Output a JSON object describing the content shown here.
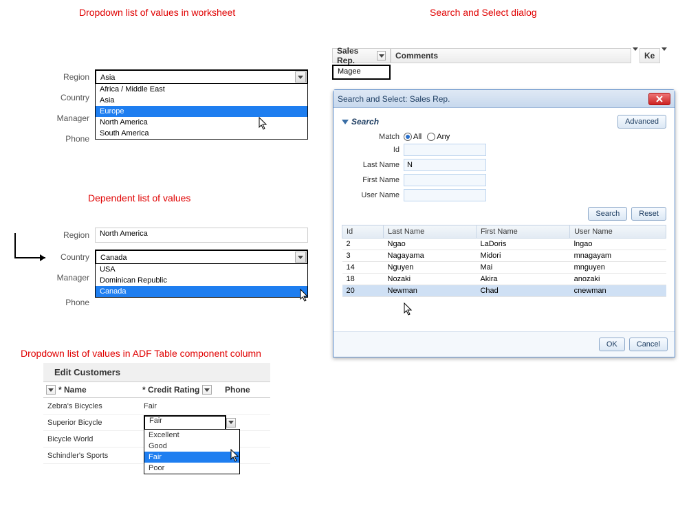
{
  "titles": {
    "lov_worksheet": "Dropdown list of values in worksheet",
    "dependent": "Dependent list of values",
    "lov_table": "Dropdown list of values in ADF Table component column",
    "search_dialog": "Search and Select dialog"
  },
  "worksheet_form": {
    "labels": {
      "region": "Region",
      "country": "Country",
      "manager": "Manager",
      "phone": "Phone"
    },
    "region_value": "Asia",
    "region_options": [
      "Africa / Middle East",
      "Asia",
      "Europe",
      "North America",
      "South America"
    ],
    "region_selected": "Europe"
  },
  "dependent_form": {
    "labels": {
      "region": "Region",
      "country": "Country",
      "manager": "Manager",
      "phone": "Phone"
    },
    "region_value": "North America",
    "country_value": "Canada",
    "country_options": [
      "USA",
      "Dominican Republic",
      "Canada"
    ],
    "country_selected": "Canada"
  },
  "table": {
    "heading": "Edit Customers",
    "columns": {
      "name": "* Name",
      "rating": "* Credit Rating",
      "phone": "Phone"
    },
    "rows": [
      {
        "name": "Zebra's Bicycles",
        "rating": "Fair"
      },
      {
        "name": "Superior Bicycle",
        "rating": "Fair"
      },
      {
        "name": "Bicycle World",
        "rating": ""
      },
      {
        "name": "Schindler's Sports",
        "rating": ""
      }
    ],
    "rating_options": [
      "Excellent",
      "Good",
      "Fair",
      "Poor"
    ],
    "rating_selected": "Fair"
  },
  "header_row": {
    "sales_rep": "Sales Rep.",
    "comments": "Comments",
    "key": "Ke",
    "sales_rep_value": "Magee"
  },
  "dialog": {
    "title": "Search and Select: Sales Rep.",
    "search_label": "Search",
    "advanced": "Advanced",
    "match_label": "Match",
    "all": "All",
    "any": "Any",
    "fields": {
      "id": "Id",
      "last": "Last Name",
      "first": "First Name",
      "user": "User Name"
    },
    "values": {
      "last": "N"
    },
    "search_btn": "Search",
    "reset_btn": "Reset",
    "columns": {
      "id": "Id",
      "last": "Last Name",
      "first": "First Name",
      "user": "User Name"
    },
    "rows": [
      {
        "id": "2",
        "last": "Ngao",
        "first": "LaDoris",
        "user": "lngao"
      },
      {
        "id": "3",
        "last": "Nagayama",
        "first": "Midori",
        "user": "mnagayam"
      },
      {
        "id": "14",
        "last": "Nguyen",
        "first": "Mai",
        "user": "mnguyen"
      },
      {
        "id": "18",
        "last": "Nozaki",
        "first": "Akira",
        "user": "anozaki"
      },
      {
        "id": "20",
        "last": "Newman",
        "first": "Chad",
        "user": "cnewman"
      }
    ],
    "selected_row": 4,
    "ok": "OK",
    "cancel": "Cancel"
  }
}
